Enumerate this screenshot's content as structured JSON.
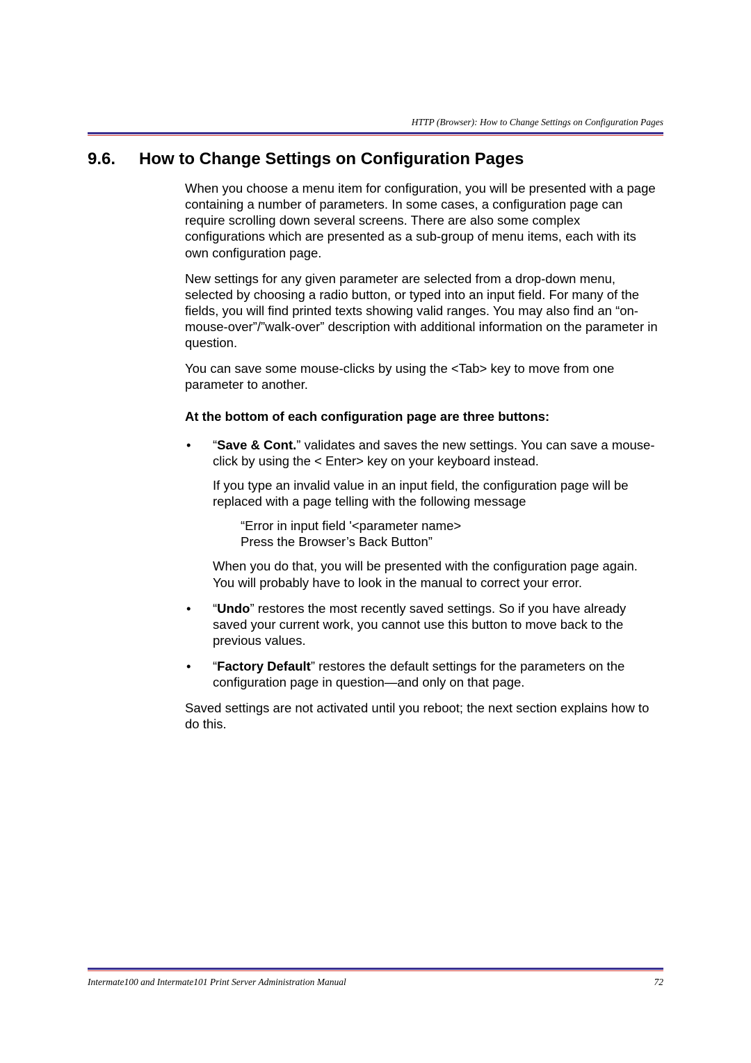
{
  "runningHeader": "HTTP (Browser): How to Change Settings on Configuration Pages",
  "section": {
    "number": "9.6.",
    "title": "How to Change Settings on Configuration Pages"
  },
  "para1": "When you choose a menu item for configuration, you will be presented with a page containing a number of parameters. In some cases, a configuration page can require scrolling down several screens. There are also some complex configurations which are presented as a sub-group of menu items, each with its own configuration page.",
  "para2": "New settings for any given parameter are selected from a drop-down menu, selected by choosing a radio button, or typed into an input field. For many of the fields, you will find printed texts showing valid ranges. You may also find an “on-mouse-over”/”walk-over” description with additional information on the parameter in question.",
  "para3": "You can save some mouse-clicks by using the <Tab> key to move from one parameter to another.",
  "subhead": "At the bottom of each configuration page are three buttons:",
  "bullets": {
    "b1": {
      "openQuote": "“",
      "strong": "Save & Cont.",
      "rest": "” validates and saves the new settings. You can save a mouse-click by using the < Enter> key on your keyboard instead.",
      "p2": "If you type an invalid value in an input field, the configuration page will be replaced with a page telling with the following message",
      "quote1": "“Error in input field '<parameter name>",
      "quote2": "Press the Browser’s Back Button”",
      "p3": "When you do that, you will be presented with the configuration page again. You will probably have to look in the manual to correct your error."
    },
    "b2": {
      "openQuote": "“",
      "strong": "Undo",
      "rest": "” restores the most recently saved settings. So if you have already saved your current work, you cannot use this button to move back to the previous values."
    },
    "b3": {
      "openQuote": "“",
      "strong": "Factory Default",
      "rest": "” restores the default settings for the parameters on the configuration page in question—and only on that page."
    }
  },
  "closing": "Saved settings are not activated until you reboot; the next section explains how to do this.",
  "footer": {
    "left": "Intermate100 and Intermate101 Print Server Administration Manual",
    "right": "72"
  }
}
